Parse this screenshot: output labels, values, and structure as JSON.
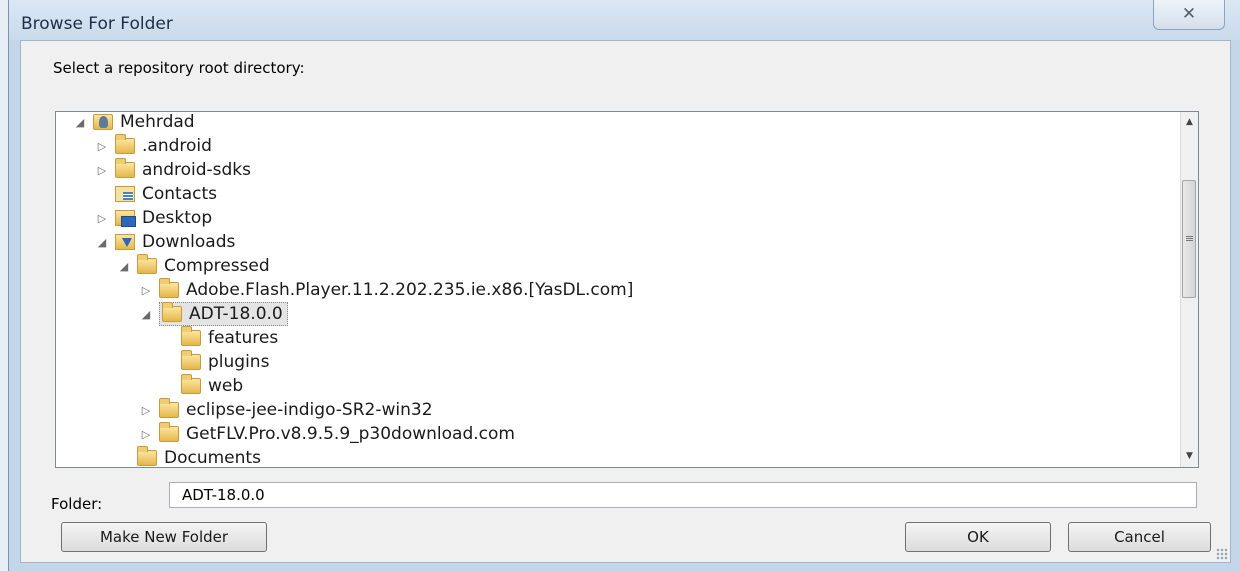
{
  "window": {
    "title": "Browse For Folder",
    "close_glyph": "✕"
  },
  "dialog": {
    "prompt": "Select a repository root directory:"
  },
  "tree": {
    "items": [
      {
        "label": "Mehrdad",
        "icon": "user-folder-icon",
        "expander": "expanded"
      },
      {
        "label": ".android",
        "icon": "folder-icon",
        "expander": "collapsed"
      },
      {
        "label": "android-sdks",
        "icon": "folder-icon",
        "expander": "collapsed"
      },
      {
        "label": "Contacts",
        "icon": "contacts-folder-icon",
        "expander": "none"
      },
      {
        "label": "Desktop",
        "icon": "desktop-folder-icon",
        "expander": "collapsed"
      },
      {
        "label": "Downloads",
        "icon": "downloads-folder-icon",
        "expander": "expanded"
      },
      {
        "label": "Compressed",
        "icon": "folder-icon",
        "expander": "expanded"
      },
      {
        "label": "Adobe.Flash.Player.11.2.202.235.ie.x86.[YasDL.com]",
        "icon": "folder-icon",
        "expander": "collapsed"
      },
      {
        "label": "ADT-18.0.0",
        "icon": "folder-icon",
        "expander": "expanded",
        "selected": true
      },
      {
        "label": "features",
        "icon": "folder-icon",
        "expander": "none"
      },
      {
        "label": "plugins",
        "icon": "folder-icon",
        "expander": "none"
      },
      {
        "label": "web",
        "icon": "folder-icon",
        "expander": "none"
      },
      {
        "label": "eclipse-jee-indigo-SR2-win32",
        "icon": "folder-icon",
        "expander": "collapsed"
      },
      {
        "label": "GetFLV.Pro.v8.9.5.9_p30download.com",
        "icon": "folder-icon",
        "expander": "collapsed"
      },
      {
        "label": "Documents",
        "icon": "folder-icon",
        "expander": "none"
      }
    ]
  },
  "folder_field": {
    "label": "Folder:",
    "value": "ADT-18.0.0"
  },
  "buttons": {
    "make_new_folder": "Make New Folder",
    "ok": "OK",
    "cancel": "Cancel"
  }
}
